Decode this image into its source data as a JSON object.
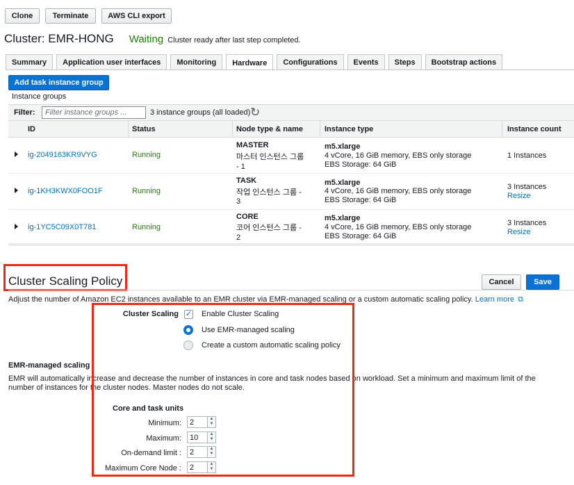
{
  "toolbar": {
    "clone": "Clone",
    "terminate": "Terminate",
    "aws_cli_export": "AWS CLI export"
  },
  "cluster": {
    "title": "Cluster: EMR-HONG",
    "state": "Waiting",
    "state_message": "Cluster ready after last step completed."
  },
  "tabs": [
    {
      "label": "Summary"
    },
    {
      "label": "Application user interfaces"
    },
    {
      "label": "Monitoring"
    },
    {
      "label": "Hardware",
      "active": true
    },
    {
      "label": "Configurations"
    },
    {
      "label": "Events"
    },
    {
      "label": "Steps"
    },
    {
      "label": "Bootstrap actions"
    }
  ],
  "hardware": {
    "add_task_button": "Add task instance group",
    "instance_groups_label": "Instance groups",
    "filter_label": "Filter:",
    "filter_placeholder": "Filter instance groups ...",
    "filter_count": "3 instance groups (all loaded)",
    "columns": [
      "ID",
      "Status",
      "Node type & name",
      "Instance type",
      "Instance count"
    ],
    "rows": [
      {
        "id": "ig-2049163KR9VYG",
        "status": "Running",
        "node_type": "MASTER",
        "node_name_1": "마스터 인스턴스 그룹",
        "node_name_2": "- 1",
        "instance_type": "m5.xlarge",
        "spec": "4 vCore, 16 GiB memory, EBS only storage",
        "ebs": "EBS Storage:  64 GiB",
        "count": "1 Instances",
        "resize": ""
      },
      {
        "id": "ig-1KH3KWX0FOO1F",
        "status": "Running",
        "node_type": "TASK",
        "node_name_1": "작업 인스턴스 그룹 -",
        "node_name_2": "3",
        "instance_type": "m5.xlarge",
        "spec": "4 vCore, 16 GiB memory, EBS only storage",
        "ebs": "EBS Storage:  64 GiB",
        "count": "3 Instances",
        "resize": "Resize"
      },
      {
        "id": "ig-1YC5C09X0T781",
        "status": "Running",
        "node_type": "CORE",
        "node_name_1": "코어 인스턴스 그룹 -",
        "node_name_2": "2",
        "instance_type": "m5.xlarge",
        "spec": "4 vCore, 16 GiB memory, EBS only storage",
        "ebs": "EBS Storage:  64 GiB",
        "count": "3 Instances",
        "resize": "Resize"
      }
    ]
  },
  "scaling": {
    "title": "Cluster Scaling Policy",
    "cancel": "Cancel",
    "save": "Save",
    "description": "Adjust the number of Amazon EC2 instances available to an EMR cluster via EMR-managed scaling or a custom automatic scaling policy.",
    "learn_more": "Learn more",
    "cluster_scaling_label": "Cluster Scaling",
    "enable_label": "Enable Cluster Scaling",
    "enable_checked": true,
    "option_managed": "Use EMR-managed scaling",
    "option_custom": "Create a custom automatic scaling policy",
    "selected_option": "managed",
    "managed_heading": "EMR-managed scaling",
    "managed_desc_1": "EMR will automatically increase and decrease the number of instances in core and task nodes based on workload. Set a minimum and maximum limit of the",
    "managed_desc_2": "number of instances for the cluster nodes. Master nodes do not scale.",
    "units_heading": "Core and task units",
    "minimum_label": "Minimum:",
    "minimum_value": "2",
    "maximum_label": "Maximum:",
    "maximum_value": "10",
    "ondemand_label": "On-demand limit :",
    "ondemand_value": "2",
    "maxcore_label": "Maximum Core Node :",
    "maxcore_value": "2"
  },
  "colors": {
    "primary": "#0972d3",
    "running": "#1d8102",
    "link": "#0073bb",
    "highlight": "#f02a10"
  }
}
